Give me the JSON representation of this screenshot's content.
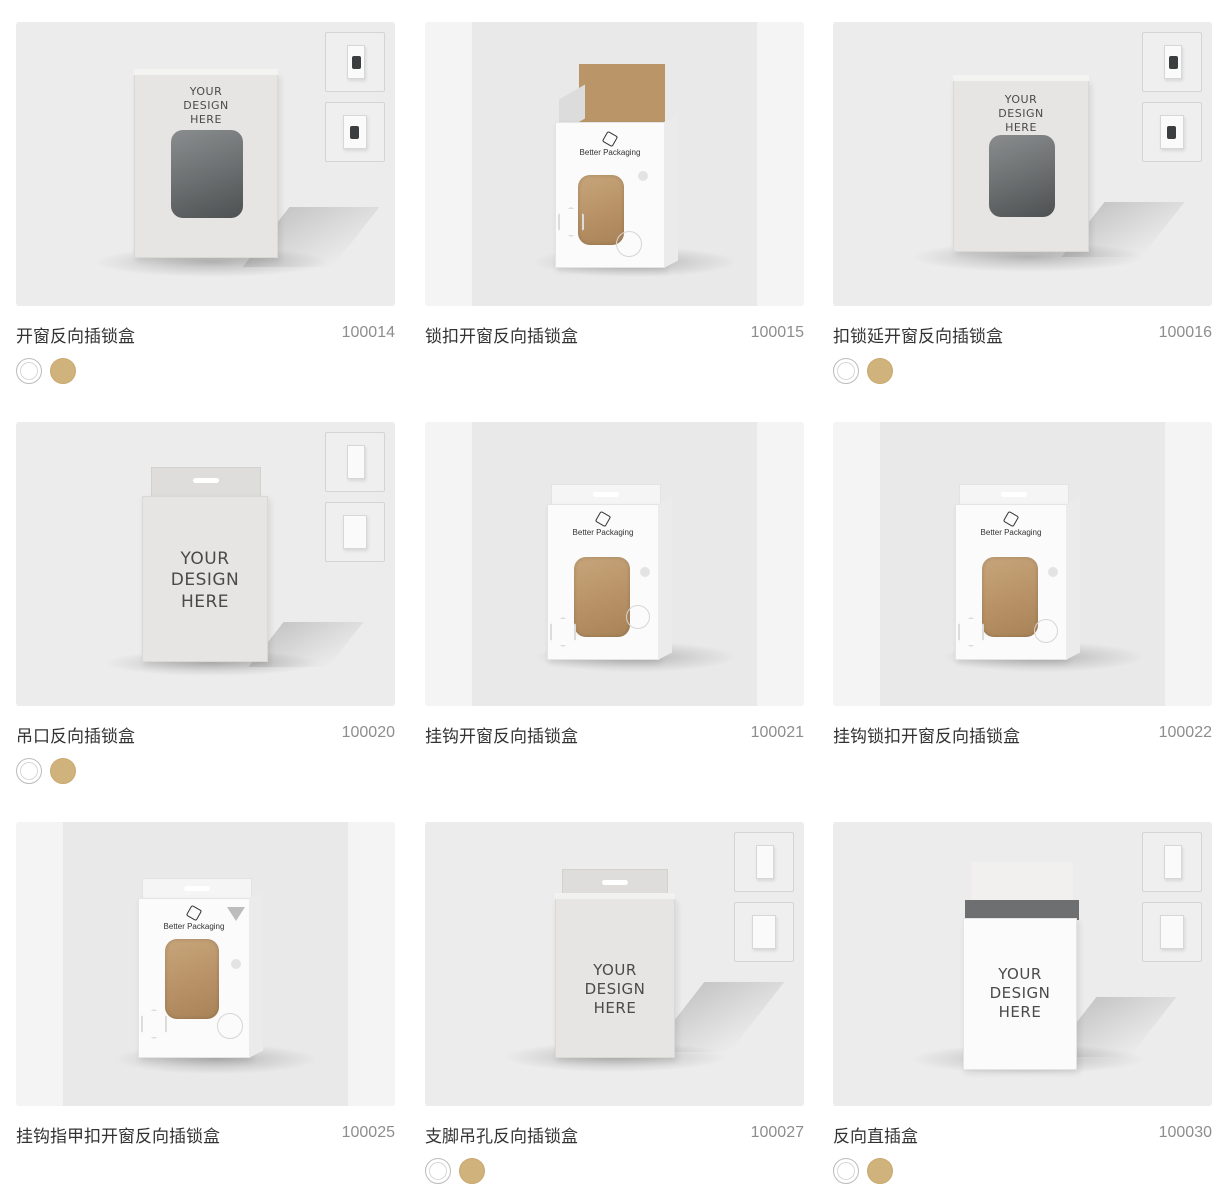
{
  "products": [
    {
      "title": "开窗反向插锁盒",
      "code": "100014",
      "swatches": [
        "white",
        "kraft"
      ]
    },
    {
      "title": "锁扣开窗反向插锁盒",
      "code": "100015",
      "swatches": []
    },
    {
      "title": "扣锁延开窗反向插锁盒",
      "code": "100016",
      "swatches": [
        "white",
        "kraft"
      ]
    },
    {
      "title": "吊口反向插锁盒",
      "code": "100020",
      "swatches": [
        "white",
        "kraft"
      ]
    },
    {
      "title": "挂钩开窗反向插锁盒",
      "code": "100021",
      "swatches": []
    },
    {
      "title": "挂钩锁扣开窗反向插锁盒",
      "code": "100022",
      "swatches": []
    },
    {
      "title": "挂钩指甲扣开窗反向插锁盒",
      "code": "100025",
      "swatches": []
    },
    {
      "title": "支脚吊孔反向插锁盒",
      "code": "100027",
      "swatches": [
        "white",
        "kraft"
      ]
    },
    {
      "title": "反向直插盒",
      "code": "100030",
      "swatches": [
        "white",
        "kraft"
      ]
    }
  ],
  "placeholder": {
    "line1": "YOUR",
    "line2": "DESIGN",
    "line3": "HERE"
  },
  "brand": "Better Packaging",
  "colors": {
    "kraft": "#d0b27c",
    "white": "#ffffff",
    "tile_bg": "#ececec"
  },
  "icons": [
    "white-swatch",
    "kraft-swatch",
    "box-thumbnail"
  ]
}
